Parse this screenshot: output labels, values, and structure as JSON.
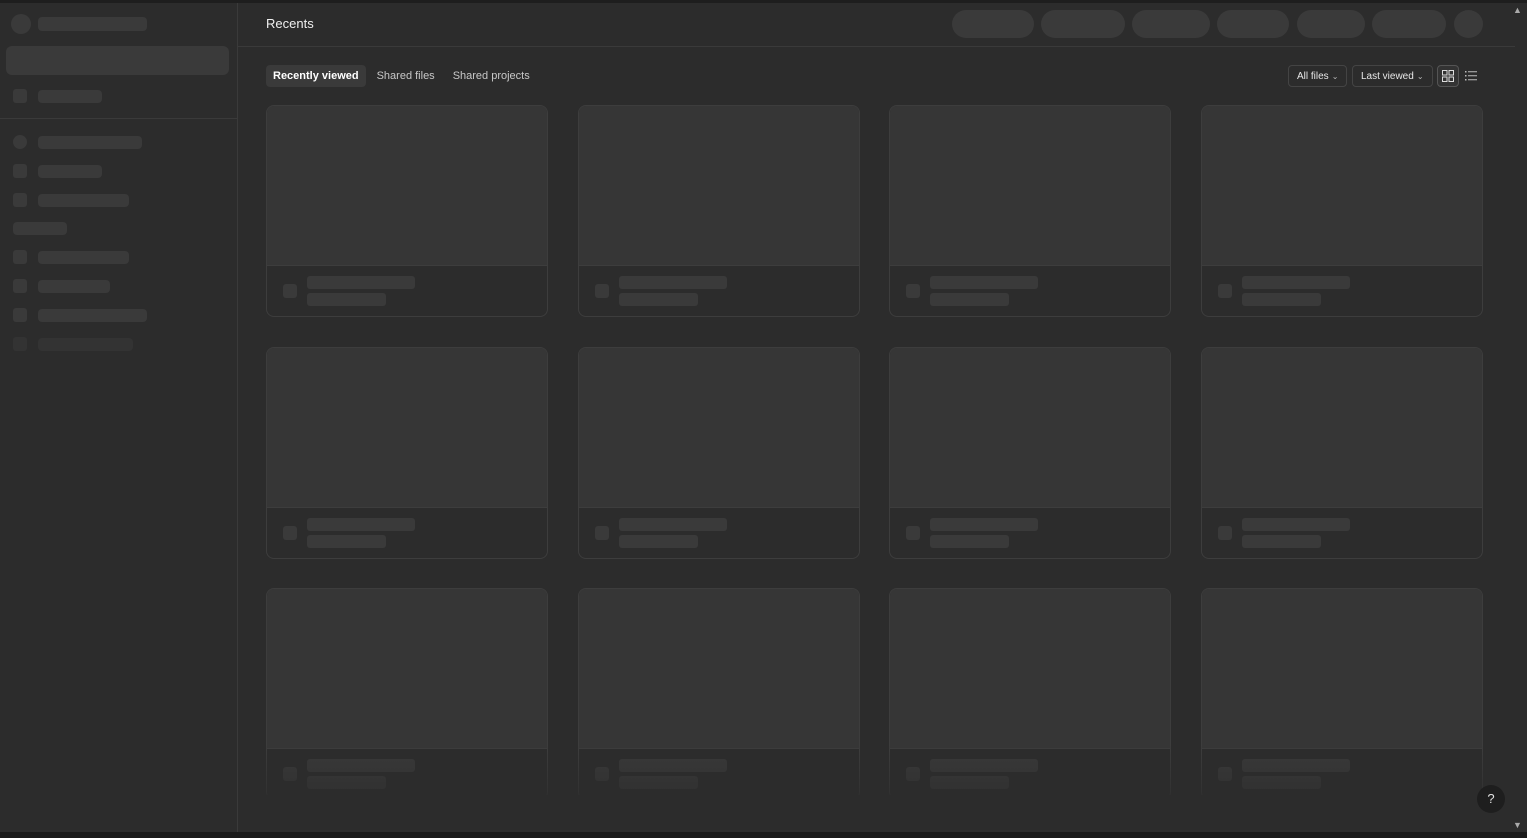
{
  "header": {
    "title": "Recents"
  },
  "tabs": [
    {
      "label": "Recently viewed",
      "active": true
    },
    {
      "label": "Shared files",
      "active": false
    },
    {
      "label": "Shared projects",
      "active": false
    }
  ],
  "filters": {
    "files_label": "All files",
    "sort_label": "Last viewed"
  },
  "view_toggle": {
    "grid_icon": "grid-icon",
    "list_icon": "list-icon",
    "active": "grid"
  },
  "help": {
    "label": "?"
  },
  "colors": {
    "background": "#2c2c2c",
    "skeleton": "#3a3a3a",
    "thumbnail": "#363636",
    "border": "#3d3d3d"
  }
}
